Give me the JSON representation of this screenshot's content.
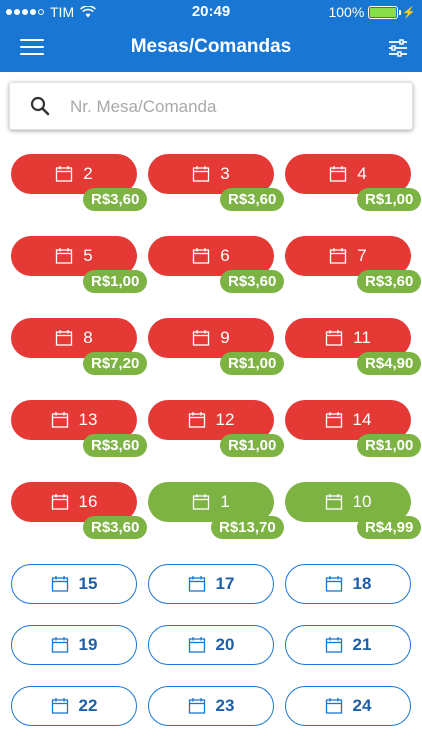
{
  "status": {
    "carrier": "TIM",
    "time": "20:49",
    "battery": "100%"
  },
  "header": {
    "title": "Mesas/Comandas"
  },
  "search": {
    "placeholder": "Nr. Mesa/Comanda"
  },
  "colors": {
    "header": "#1976d2",
    "occupied": "#e53935",
    "paid": "#7cb342",
    "free_border": "#1976d2"
  },
  "tables": [
    {
      "number": "2",
      "status": "occupied",
      "amount": "R$3,60"
    },
    {
      "number": "3",
      "status": "occupied",
      "amount": "R$3,60"
    },
    {
      "number": "4",
      "status": "occupied",
      "amount": "R$1,00"
    },
    {
      "number": "5",
      "status": "occupied",
      "amount": "R$1,00"
    },
    {
      "number": "6",
      "status": "occupied",
      "amount": "R$3,60"
    },
    {
      "number": "7",
      "status": "occupied",
      "amount": "R$3,60"
    },
    {
      "number": "8",
      "status": "occupied",
      "amount": "R$7,20"
    },
    {
      "number": "9",
      "status": "occupied",
      "amount": "R$1,00"
    },
    {
      "number": "11",
      "status": "occupied",
      "amount": "R$4,90"
    },
    {
      "number": "13",
      "status": "occupied",
      "amount": "R$3,60"
    },
    {
      "number": "12",
      "status": "occupied",
      "amount": "R$1,00"
    },
    {
      "number": "14",
      "status": "occupied",
      "amount": "R$1,00"
    },
    {
      "number": "16",
      "status": "occupied",
      "amount": "R$3,60"
    },
    {
      "number": "1",
      "status": "green",
      "amount": "R$13,70"
    },
    {
      "number": "10",
      "status": "green",
      "amount": "R$4,99"
    },
    {
      "number": "15",
      "status": "free"
    },
    {
      "number": "17",
      "status": "free"
    },
    {
      "number": "18",
      "status": "free"
    },
    {
      "number": "19",
      "status": "free"
    },
    {
      "number": "20",
      "status": "free"
    },
    {
      "number": "21",
      "status": "free"
    },
    {
      "number": "22",
      "status": "free"
    },
    {
      "number": "23",
      "status": "free"
    },
    {
      "number": "24",
      "status": "free"
    }
  ]
}
